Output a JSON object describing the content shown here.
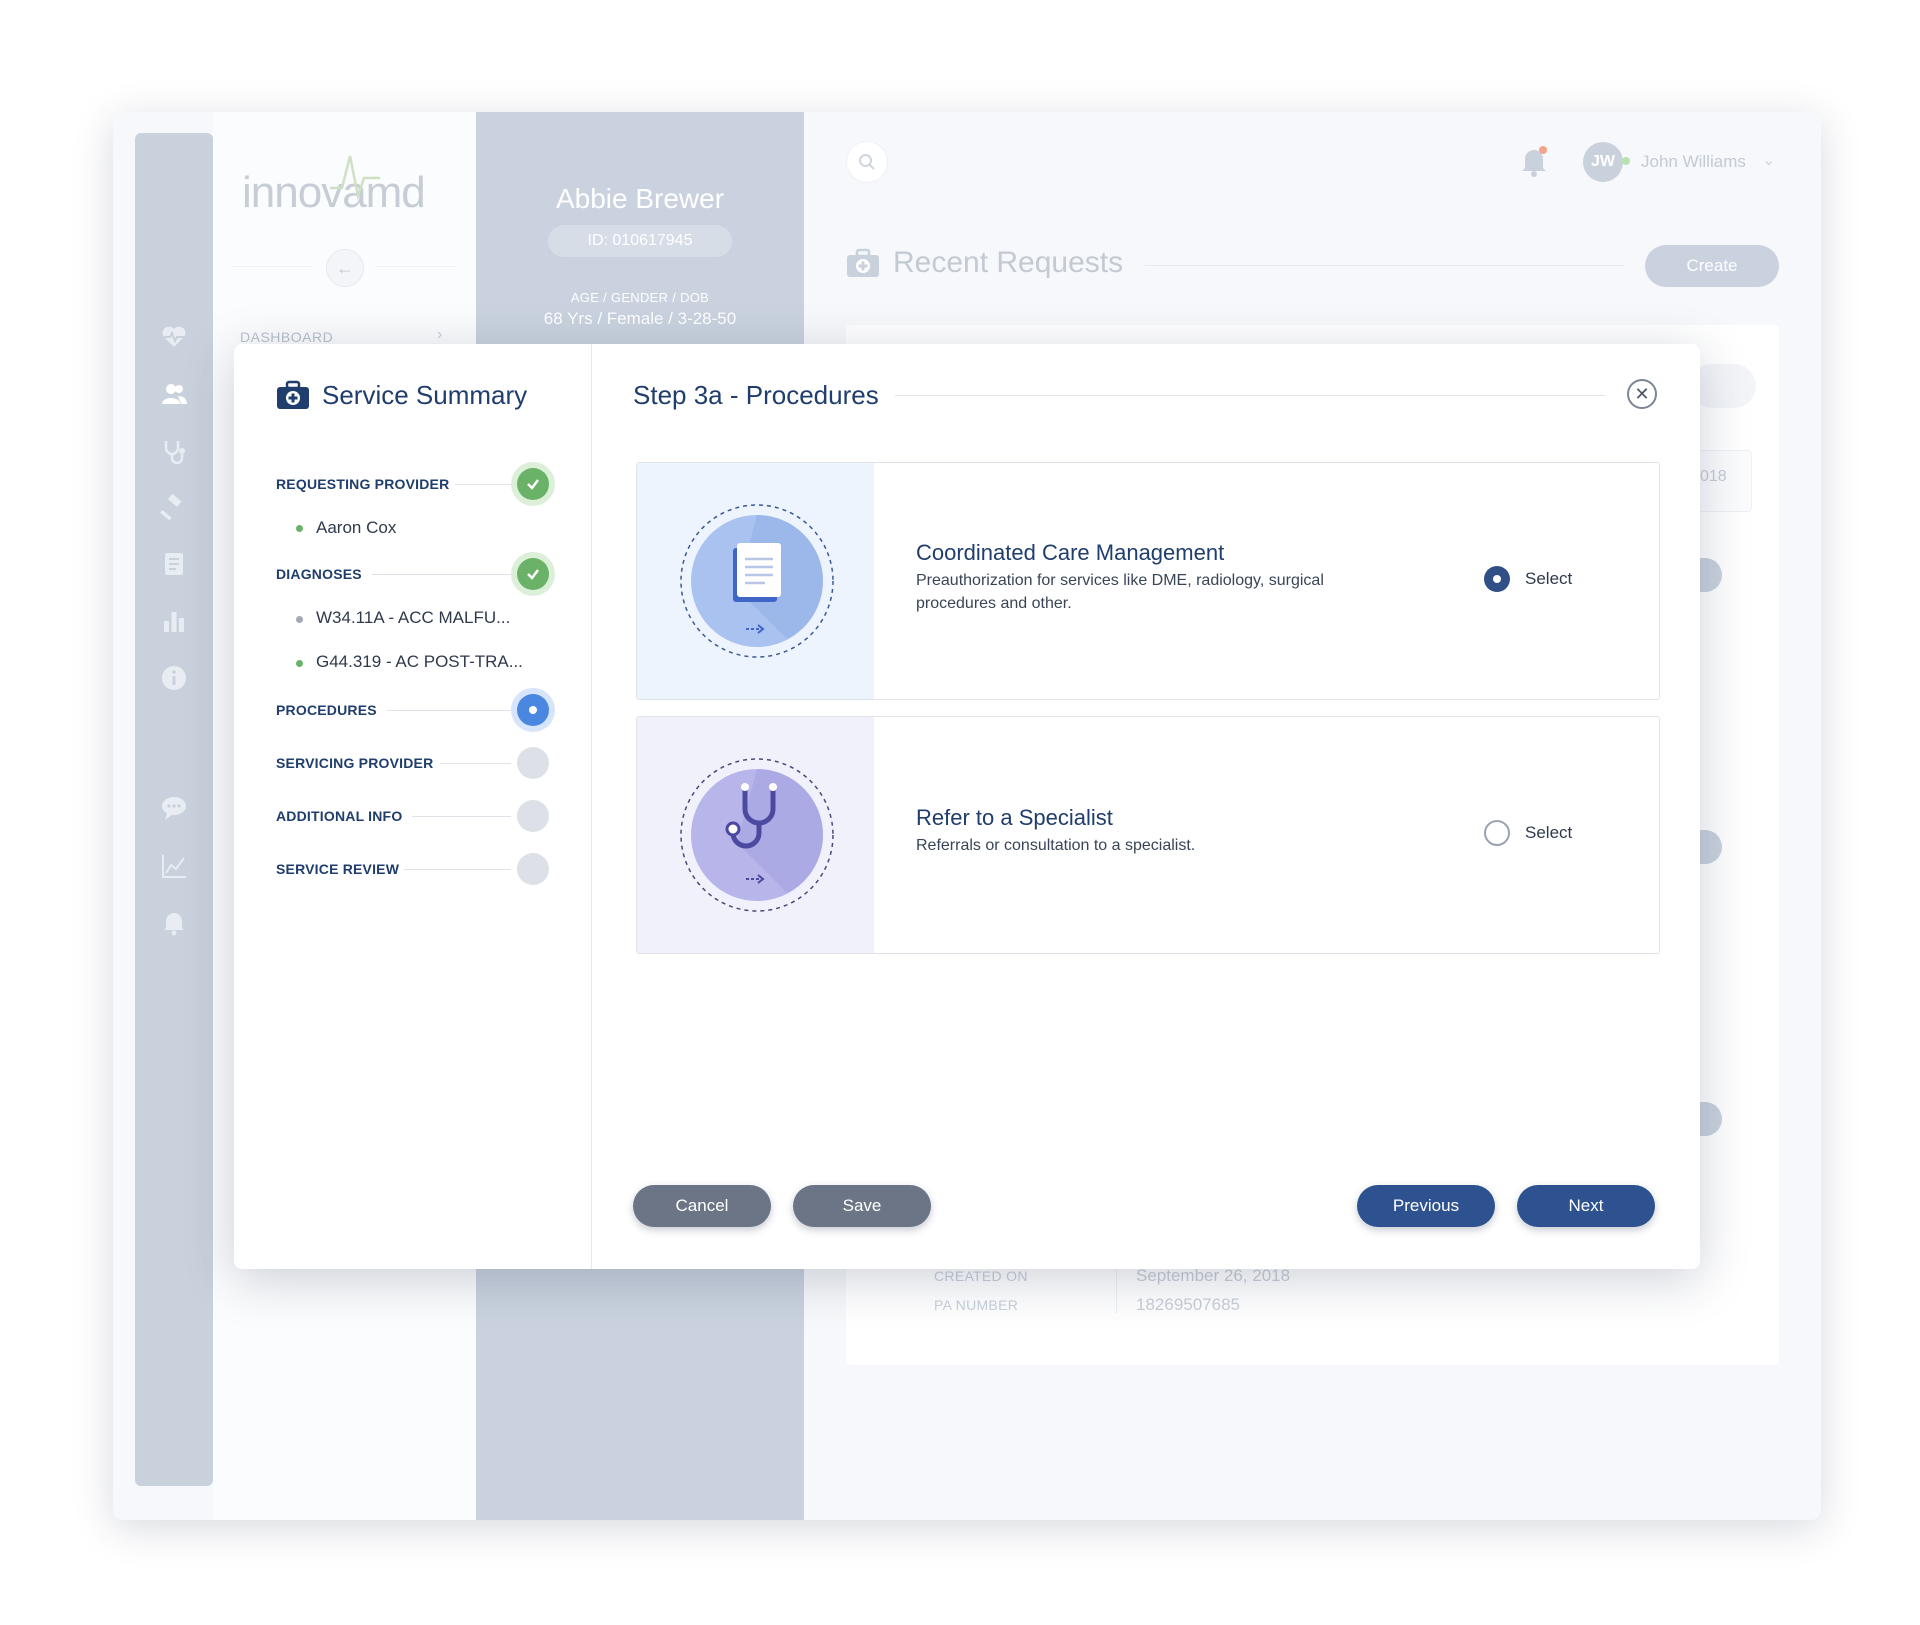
{
  "brand": {
    "logo_text": "innovamd"
  },
  "sidebar": {
    "dashboard_label": "DASHBOARD"
  },
  "patient": {
    "name": "Abbie Brewer",
    "id": "ID:  010617945",
    "meta_label": "AGE / GENDER / DOB",
    "meta_value": "68 Yrs / Female / 3-28-50"
  },
  "header": {
    "user_initials": "JW",
    "user_name": "John Williams",
    "page_title": "Recent Requests",
    "create_label": "Create"
  },
  "background_card": {
    "year_fragment": "018",
    "rows": [
      {
        "label": "CREATED ON",
        "value": "September 26, 2018"
      },
      {
        "label": "PA NUMBER",
        "value": "18269507685"
      }
    ]
  },
  "modal": {
    "summary_title": "Service Summary",
    "step_title": "Step 3a - Procedures",
    "steps": [
      {
        "label": "REQUESTING PROVIDER",
        "status": "done",
        "items": [
          "Aaron Cox"
        ]
      },
      {
        "label": "DIAGNOSES",
        "status": "done",
        "items": [
          "W34.11A - ACC MALFU...",
          "G44.319 - AC POST-TRA..."
        ]
      },
      {
        "label": "PROCEDURES",
        "status": "current",
        "items": []
      },
      {
        "label": "SERVICING PROVIDER",
        "status": "pending",
        "items": []
      },
      {
        "label": "ADDITIONAL INFO",
        "status": "pending",
        "items": []
      },
      {
        "label": "SERVICE REVIEW",
        "status": "pending",
        "items": []
      }
    ],
    "options": [
      {
        "title": "Coordinated Care Management",
        "description": "Preauthorization for services like DME, radiology, surgical procedures and other.",
        "select_label": "Select",
        "selected": true,
        "icon": "document-icon"
      },
      {
        "title": "Refer to a Specialist",
        "description": "Referrals or consultation to a specialist.",
        "select_label": "Select",
        "selected": false,
        "icon": "stethoscope-icon"
      }
    ],
    "buttons": {
      "cancel": "Cancel",
      "save": "Save",
      "previous": "Previous",
      "next": "Next"
    }
  },
  "colors": {
    "primary": "#2d528f",
    "title": "#1f3d6d",
    "success": "#6ab267",
    "current": "#4a87e0",
    "neutral_button": "#6b7585"
  }
}
